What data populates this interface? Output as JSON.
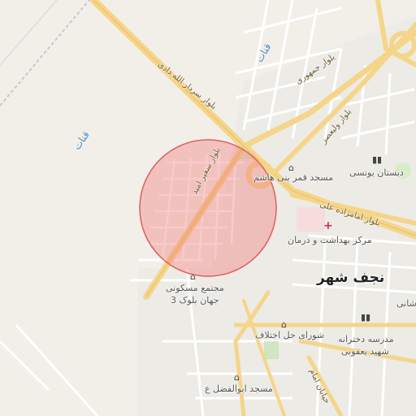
{
  "map": {
    "city_label": "نجف شهر",
    "highlight_color": "#f08080",
    "water_labels": [
      "قنات",
      "قنات"
    ],
    "roads": {
      "sardar": "بلوار سردار الله دادی",
      "jomhouri": "بلوار جمهوری",
      "valiasr": "بلوار ولیعصر",
      "safir": "بلوار سفیر امید",
      "imamzadeh": "بلوار امامزاده علی",
      "khayaban_imam": "خیابان امام"
    },
    "pois": {
      "mosque_qamar": "مسجد قمر بنی هاشم",
      "school_younesi": "دبستان یونسی",
      "health_center": "مرکز بهداشت و درمان",
      "complex_line1": "مجتمع مسکونی",
      "complex_line2": "جهان بلوک 3",
      "council": "شورای حل اختلاف",
      "girls_school_line1": "مدرسه دخترانه",
      "girls_school_line2": "شهید یعقوبی",
      "mosque_abolfazl": "مسجد ابوالفضل ع",
      "partial_label": "شانی"
    },
    "icons": {
      "mosque": "mosque-icon",
      "school": "school-icon",
      "hospital": "hospital-icon",
      "building": "building-icon",
      "government": "government-icon"
    }
  }
}
